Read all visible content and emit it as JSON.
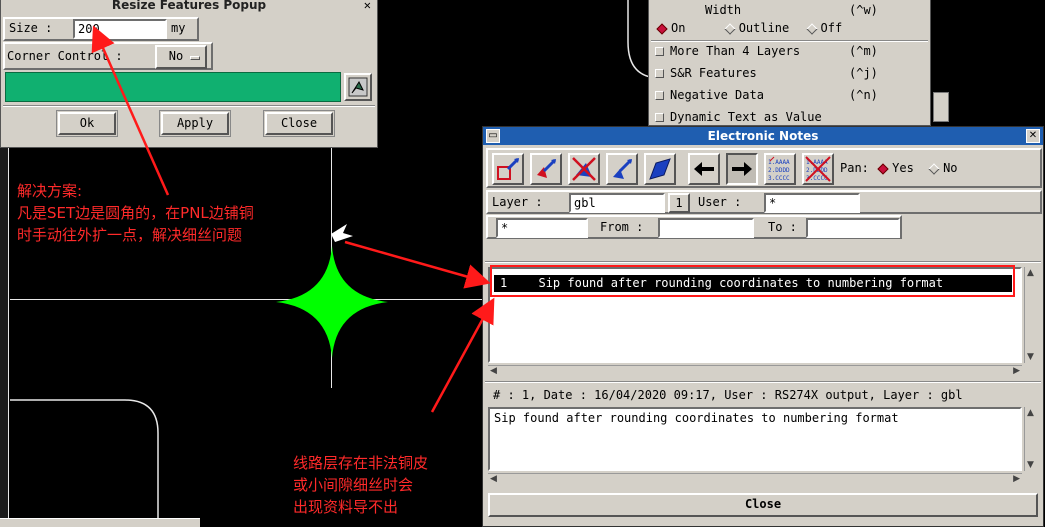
{
  "resize_popup": {
    "title": "Resize Features Popup",
    "close_glyph": "✕",
    "size_label": "Size :",
    "size_value": "200",
    "size_unit": "my",
    "corner_label": "Corner Control :",
    "corner_value": "No",
    "ok_label": "Ok",
    "apply_label": "Apply",
    "close_label": "Close",
    "green_color": "#10b070"
  },
  "display_menu": {
    "width_label": "Width",
    "width_shortcut": "(^w)",
    "on_label": "On",
    "outline_label": "Outline",
    "off_label": "Off",
    "items": [
      {
        "label": "More Than 4 Layers",
        "shortcut": "(^m)"
      },
      {
        "label": "S&R Features",
        "shortcut": "(^j)"
      },
      {
        "label": "Negative Data",
        "shortcut": "(^n)"
      },
      {
        "label": "Dynamic Text as Value",
        "shortcut": ""
      }
    ]
  },
  "notes": {
    "title": "Electronic Notes",
    "pan_label": "Pan:",
    "pan_yes": "Yes",
    "pan_no": "No",
    "layer_label": "Layer :",
    "layer_value": "gbl",
    "layer_count": "1",
    "user_label": "User :",
    "user_value": "*",
    "filter_value": "*",
    "from_label": "From :",
    "from_value": "",
    "to_label": "To :",
    "to_value": "",
    "list_item_num": "1",
    "list_item_text": "Sip found after rounding coordinates to numbering format",
    "info_line": "# : 1, Date : 16/04/2020 09:17, User : RS274X output, Layer : gbl",
    "note_text": "Sip found after rounding coordinates to numbering format",
    "close_label": "Close",
    "list_icon_a": "1.AAAA\n2.DDDD\n3.CCCC",
    "toolbar_icons": [
      "add-note-icon",
      "edit-note-icon",
      "delete-note-icon",
      "move-note-icon",
      "show-note-icon",
      "previous-icon",
      "next-icon",
      "list-notes-icon",
      "clear-list-icon"
    ]
  },
  "annotations": {
    "solution_lines": [
      "解决方案:",
      "凡是SET边是圆角的，在PNL边铺铜",
      "时手动往外扩一点，解决细丝问题"
    ],
    "cause_lines": [
      "线路层存在非法铜皮",
      "或小间隙细丝时会",
      "出现资料导不出"
    ],
    "color": "#ff2a2a"
  },
  "colors": {
    "shape_fill": "#00ff00",
    "titlebar": "#1f5eb0"
  }
}
